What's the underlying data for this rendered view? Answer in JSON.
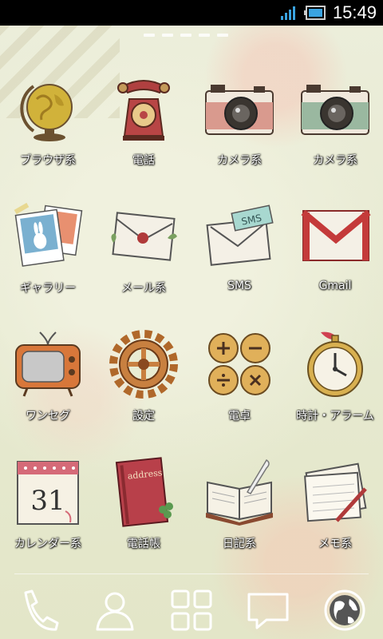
{
  "status_bar": {
    "time": "15:49",
    "signal_icon": "signal-bars-icon",
    "battery_icon": "battery-icon"
  },
  "pager": {
    "pages": 5
  },
  "apps": [
    {
      "label": "ブラウザ系",
      "icon": "globe-icon"
    },
    {
      "label": "電話",
      "icon": "rotary-telephone-icon"
    },
    {
      "label": "カメラ系",
      "icon": "camera-pink-icon"
    },
    {
      "label": "カメラ系",
      "icon": "camera-green-icon"
    },
    {
      "label": "ギャラリー",
      "icon": "photos-icon"
    },
    {
      "label": "メール系",
      "icon": "envelope-icon"
    },
    {
      "label": "SMS",
      "icon": "sms-envelope-icon"
    },
    {
      "label": "Gmail",
      "icon": "gmail-icon"
    },
    {
      "label": "ワンセグ",
      "icon": "tv-icon"
    },
    {
      "label": "設定",
      "icon": "gear-icon"
    },
    {
      "label": "電卓",
      "icon": "calculator-buttons-icon"
    },
    {
      "label": "時計・アラーム",
      "icon": "pocket-watch-icon"
    },
    {
      "label": "カレンダー系",
      "icon": "calendar-icon"
    },
    {
      "label": "電話帳",
      "icon": "address-book-icon"
    },
    {
      "label": "日記系",
      "icon": "diary-icon"
    },
    {
      "label": "メモ系",
      "icon": "memo-icon"
    }
  ],
  "calendar_day": "31",
  "address_book_text": "address",
  "sms_text": "SMS",
  "dock": [
    {
      "icon": "phone-handset-icon"
    },
    {
      "icon": "contacts-person-icon"
    },
    {
      "icon": "app-drawer-grid-icon"
    },
    {
      "icon": "speech-bubble-icon"
    },
    {
      "icon": "browser-globe-icon"
    }
  ]
}
